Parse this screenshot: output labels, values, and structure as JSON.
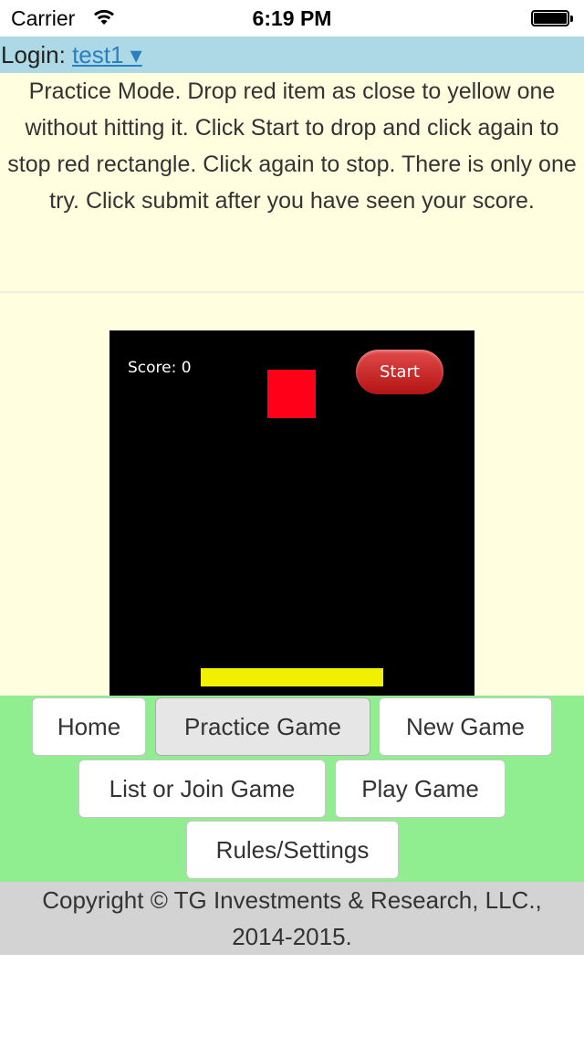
{
  "status_bar": {
    "carrier": "Carrier",
    "time": "6:19 PM",
    "wifi_icon": "wifi-icon",
    "battery_icon": "battery-icon"
  },
  "login": {
    "label": "Login:",
    "user": "test1 ▾"
  },
  "instructions": "Practice Mode. Drop red item as close to yellow one without hitting it. Click Start to drop and click again to stop red rectangle. Click again to stop. There is only one try. Click submit after you have seen your score.",
  "game": {
    "score_label": "Score: 0",
    "start_label": "Start",
    "colors": {
      "background": "#000000",
      "red_item": "#ff0018",
      "yellow_item": "#f0f000",
      "start_button": "#c62b2b"
    }
  },
  "nav": {
    "home": "Home",
    "practice_game": "Practice Game",
    "new_game": "New Game",
    "list_or_join": "List or Join Game",
    "play_game": "Play Game",
    "rules_settings": "Rules/Settings",
    "active": "Practice Game"
  },
  "footer": {
    "line1": "Copyright © TG Investments & Research, LLC.,",
    "line2": "2014-2015."
  },
  "colors": {
    "login_bar": "#add8e6",
    "page_bg": "#fffedf",
    "nav_bg": "#90ee90",
    "footer_bg": "#d3d3d3"
  }
}
